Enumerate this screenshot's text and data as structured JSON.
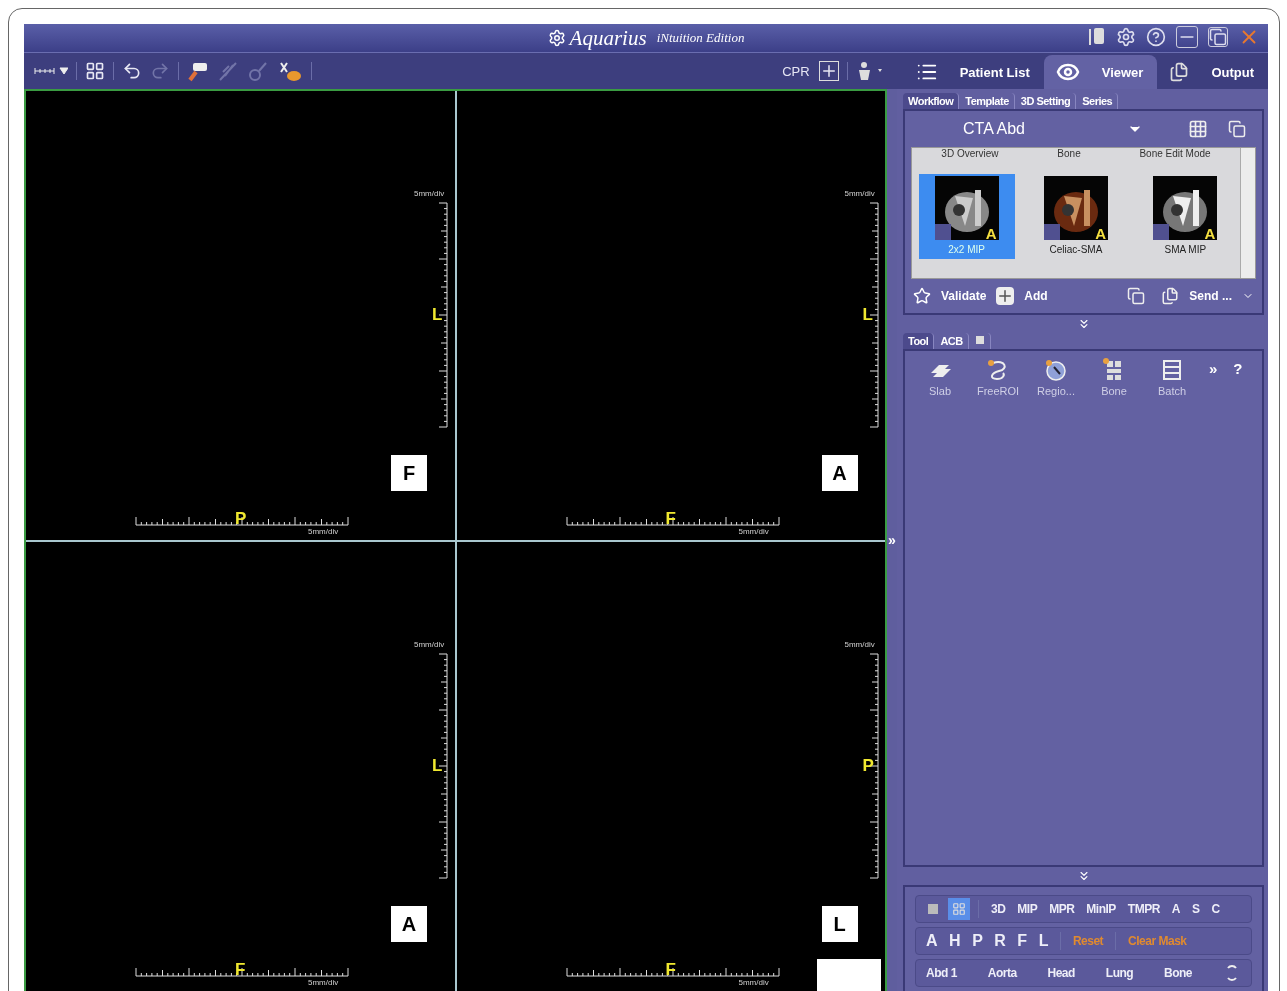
{
  "window": {
    "title": "Aquarius",
    "edition": "iNtuition Edition"
  },
  "toolbar": {
    "cpr_label": "CPR"
  },
  "main_tabs": [
    {
      "label": "Patient List",
      "selected": false,
      "kind": "list"
    },
    {
      "label": "Viewer",
      "selected": true,
      "kind": "eye"
    },
    {
      "label": "Output",
      "selected": false,
      "kind": "pages"
    }
  ],
  "viewports": [
    {
      "scale_top": "5mm/div",
      "side_letter": "L",
      "cube_letter": "F",
      "bottom_letter": "P",
      "scale_bottom": "5mm/div"
    },
    {
      "scale_top": "5mm/div",
      "side_letter": "L",
      "cube_letter": "A",
      "bottom_letter": "F",
      "scale_bottom": "5mm/div"
    },
    {
      "scale_top": "5mm/div",
      "side_letter": "L",
      "cube_letter": "A",
      "bottom_letter": "F",
      "scale_bottom": "5mm/div"
    },
    {
      "scale_top": "5mm/div",
      "side_letter": "P",
      "cube_letter": "L",
      "bottom_letter": "F",
      "scale_bottom": "5mm/div"
    }
  ],
  "panel_toggle": "»",
  "sub_tabs": [
    {
      "label": "Workflow",
      "selected": true
    },
    {
      "label": "Template",
      "selected": false
    },
    {
      "label": "3D Setting",
      "selected": false
    },
    {
      "label": "Series",
      "selected": false
    }
  ],
  "protocol": {
    "value": "CTA Abd"
  },
  "workflow": {
    "section_labels": [
      "3D Overview",
      "Bone",
      "Bone Edit Mode"
    ],
    "steps": [
      {
        "label": "2x2 MIP",
        "badge": "A",
        "selected": true
      },
      {
        "label": "Celiac-SMA",
        "badge": "A",
        "selected": false
      },
      {
        "label": "SMA MIP",
        "badge": "A",
        "selected": false
      }
    ]
  },
  "workflow_actions": [
    {
      "label": "Validate",
      "kind": "star"
    },
    {
      "label": "Add",
      "kind": "plus"
    },
    {
      "label": "Send ...",
      "kind": "send"
    }
  ],
  "tool_tabs": [
    {
      "label": "Tool",
      "selected": true
    },
    {
      "label": "ACB",
      "selected": false
    }
  ],
  "tools": [
    {
      "label": "Slab",
      "kind": "slab"
    },
    {
      "label": "FreeROI",
      "kind": "freeroi"
    },
    {
      "label": "Regio...",
      "kind": "region"
    },
    {
      "label": "Bone",
      "kind": "bone"
    },
    {
      "label": "Batch",
      "kind": "batch"
    }
  ],
  "tool_more": "»",
  "tool_help": "?",
  "layout_buttons": [
    {
      "selected": false
    },
    {
      "selected": true
    }
  ],
  "render_modes": [
    "3D",
    "MIP",
    "MPR",
    "MinIP",
    "TMPR",
    "A",
    "S",
    "C"
  ],
  "orientations": [
    "A",
    "H",
    "P",
    "R",
    "F",
    "L"
  ],
  "reset": "Reset",
  "clear_mask": "Clear Mask",
  "presets": [
    "Abd 1",
    "Aorta",
    "Head",
    "Lung",
    "Bone"
  ]
}
